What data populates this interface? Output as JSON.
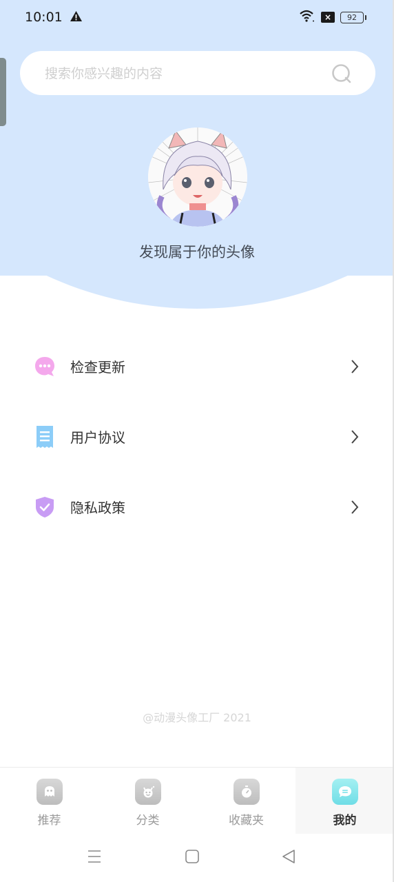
{
  "status_bar": {
    "time": "10:01",
    "battery": "92",
    "icons": [
      "warning-icon",
      "wifi-icon",
      "no-sim-icon",
      "battery-icon"
    ]
  },
  "search": {
    "placeholder": "搜索你感兴趣的内容",
    "value": "",
    "icon": "search-icon"
  },
  "hero": {
    "caption": "发现属于你的头像",
    "avatar": "anime-avatar"
  },
  "menu": {
    "items": [
      {
        "label": "检查更新",
        "icon": "chat-bubble-icon",
        "color": "#f4a8ec"
      },
      {
        "label": "用户协议",
        "icon": "receipt-icon",
        "color": "#8ccdf8"
      },
      {
        "label": "隐私政策",
        "icon": "shield-check-icon",
        "color": "#c89cf4"
      }
    ]
  },
  "footer": {
    "note": "@动漫头像工厂 2021"
  },
  "tabbar": {
    "tabs": [
      {
        "label": "推荐",
        "icon": "ghost-icon",
        "active": false
      },
      {
        "label": "分类",
        "icon": "devil-icon",
        "active": false
      },
      {
        "label": "收藏夹",
        "icon": "stopwatch-icon",
        "active": false
      },
      {
        "label": "我的",
        "icon": "message-icon",
        "active": true
      }
    ],
    "active_color": "#7fe3ea",
    "inactive_color": "#c4c4c4"
  },
  "system_nav": {
    "buttons": [
      "menu-icon",
      "home-icon",
      "back-icon"
    ]
  }
}
